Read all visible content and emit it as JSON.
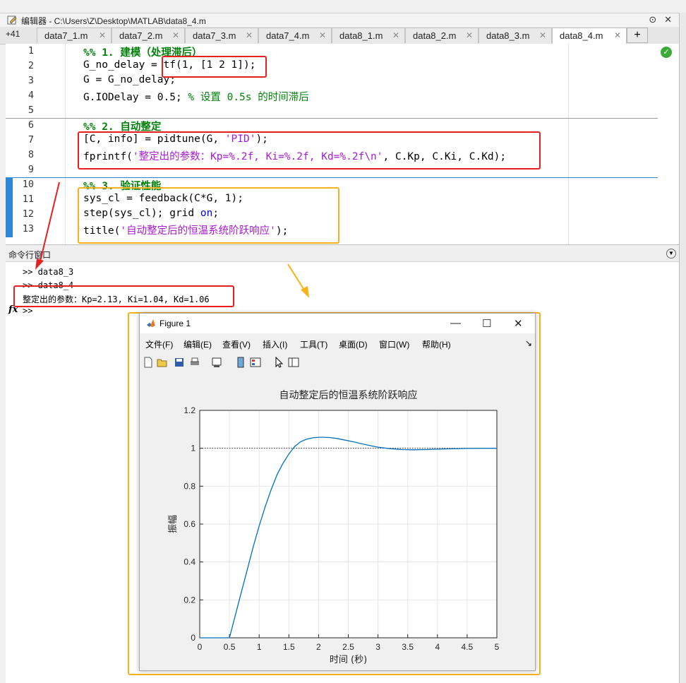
{
  "editor": {
    "title": "编辑器 - C:\\Users\\Z\\Desktop\\MATLAB\\data8_4.m",
    "title_buttons": [
      "⊙",
      "✕"
    ],
    "more_tabs": "+41",
    "tabs": [
      {
        "label": "data7_1.m"
      },
      {
        "label": "data7_2.m"
      },
      {
        "label": "data7_3.m"
      },
      {
        "label": "data7_4.m"
      },
      {
        "label": "data8_1.m"
      },
      {
        "label": "data8_2.m"
      },
      {
        "label": "data8_3.m"
      },
      {
        "label": "data8_4.m",
        "active": true
      }
    ],
    "add_tab": "+",
    "line_numbers": [
      "1",
      "2",
      "3",
      "4",
      "5",
      "6",
      "7",
      "8",
      "9",
      "10",
      "11",
      "12",
      "13"
    ],
    "code": {
      "l1": "%% 1. 建模（处理滞后）",
      "l2a": "G_no_delay = ",
      "l2b": "tf(1, [1 2 1]);",
      "l3": "G = G_no_delay;",
      "l4a": "G.IODelay = 0.5; ",
      "l4b": "% 设置 0.5s 的时间滞后",
      "l6": "%% 2. 自动整定",
      "l7a": "[C, info] = pidtune(G, ",
      "l7b": "'PID'",
      "l7c": ");",
      "l8a": "fprintf(",
      "l8b": "'整定出的参数：Kp=%.2f, Ki=%.2f, Kd=%.2f\\n'",
      "l8c": ", C.Kp, C.Ki, C.Kd);",
      "l10": "%% 3. 验证性能",
      "l11": "sys_cl = feedback(C*G, 1);",
      "l12a": "step(sys_cl); grid ",
      "l12b": "on",
      "l12c": ";",
      "l13a": "title(",
      "l13b": "'自动整定后的恒温系统阶跃响应'",
      "l13c": ");"
    }
  },
  "command_window": {
    "title": "命令行窗口",
    "lines": [
      ">> data8_3",
      ">> data8_4",
      "整定出的参数：Kp=2.13, Ki=1.04, Kd=1.06"
    ],
    "prompt_fx": "fx",
    "prompt": ">>"
  },
  "figure": {
    "title": "Figure 1",
    "window_buttons": [
      "—",
      "☐",
      "✕"
    ],
    "menus": [
      "文件(F)",
      "编辑(E)",
      "查看(V)",
      "插入(I)",
      "工具(T)",
      "桌面(D)",
      "窗口(W)",
      "帮助(H)"
    ],
    "menu_overflow": "↘"
  },
  "colors": {
    "red_box": "#e81f1f",
    "orange_box": "#f7b21a",
    "line": "#0072bd",
    "section_bar": "#2f86d8"
  },
  "chart_data": {
    "type": "line",
    "title": "自动整定后的恒温系统阶跃响应",
    "xlabel": "时间 (秒)",
    "ylabel": "振幅",
    "xlim": [
      0,
      5
    ],
    "ylim": [
      0,
      1.2
    ],
    "x_ticks": [
      "0",
      "0.5",
      "1",
      "1.5",
      "2",
      "2.5",
      "3",
      "3.5",
      "4",
      "4.5",
      "5"
    ],
    "y_ticks": [
      "0",
      "0.2",
      "0.4",
      "0.6",
      "0.8",
      "1",
      "1.2"
    ],
    "grid": true,
    "reference_line": 1,
    "series": [
      {
        "x": [
          0,
          0.5,
          0.6,
          0.7,
          0.8,
          0.9,
          1.0,
          1.1,
          1.2,
          1.3,
          1.4,
          1.5,
          1.6,
          1.7,
          1.8,
          1.9,
          2.0,
          2.1,
          2.2,
          2.3,
          2.4,
          2.6,
          2.8,
          3.0,
          3.2,
          3.4,
          3.6,
          3.8,
          4.0,
          4.2,
          4.5,
          4.8,
          5.0
        ],
        "y": [
          0,
          0,
          0.12,
          0.24,
          0.36,
          0.48,
          0.59,
          0.69,
          0.78,
          0.86,
          0.92,
          0.97,
          1.01,
          1.035,
          1.048,
          1.055,
          1.058,
          1.058,
          1.056,
          1.052,
          1.046,
          1.033,
          1.018,
          1.006,
          0.998,
          0.993,
          0.992,
          0.993,
          0.995,
          0.997,
          0.999,
          1.0,
          1.0
        ]
      }
    ]
  }
}
